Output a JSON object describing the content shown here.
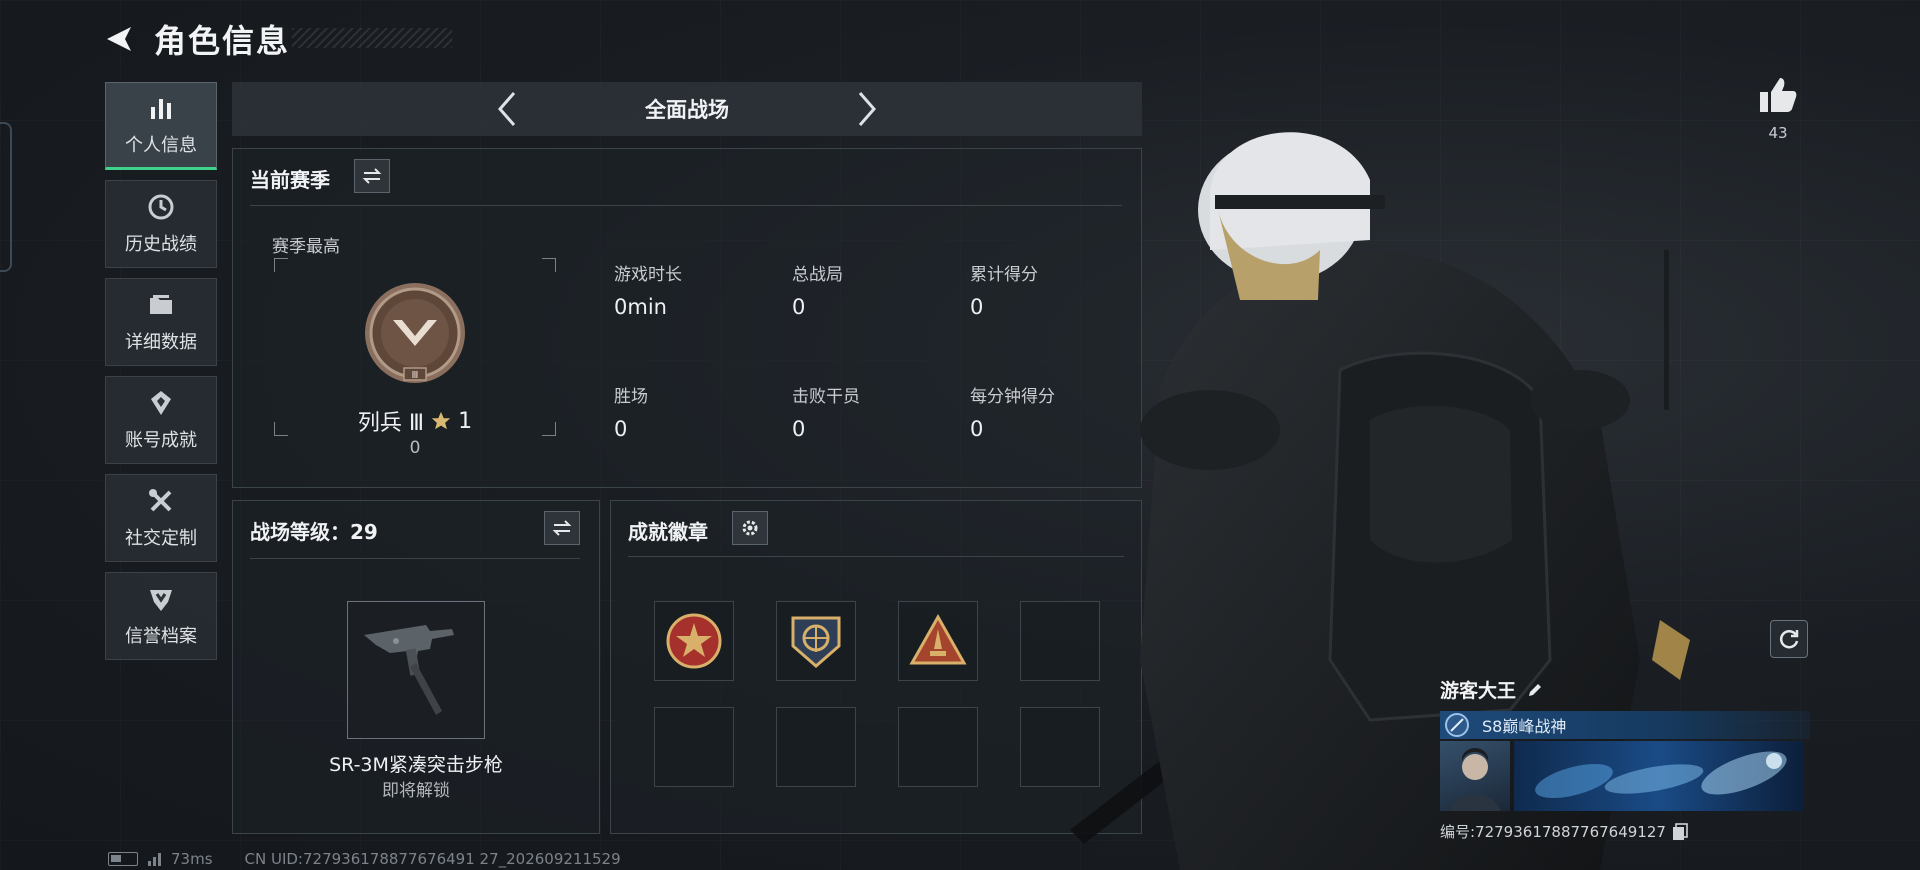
{
  "header": {
    "title": "角色信息"
  },
  "sidenav": {
    "items": [
      {
        "label": "个人信息",
        "active": true,
        "icon": "bar-chart-icon"
      },
      {
        "label": "历史战绩",
        "active": false,
        "icon": "history-clock-icon"
      },
      {
        "label": "详细数据",
        "active": false,
        "icon": "folder-stack-icon"
      },
      {
        "label": "账号成就",
        "active": false,
        "icon": "achievement-medal-icon"
      },
      {
        "label": "社交定制",
        "active": false,
        "icon": "tools-icon"
      },
      {
        "label": "信誉档案",
        "active": false,
        "icon": "shield-icon"
      }
    ],
    "active_color": "#3fd28b"
  },
  "modebar": {
    "title": "全面战场"
  },
  "season": {
    "title": "当前赛季",
    "best_label": "赛季最高",
    "rank_name": "列兵 Ⅲ",
    "rank_stars": "1",
    "rank_points": "0",
    "emblem_numeral": "Ⅲ",
    "stats": [
      {
        "label": "游戏时长",
        "value": "0min"
      },
      {
        "label": "总战局",
        "value": "0"
      },
      {
        "label": "累计得分",
        "value": "0"
      },
      {
        "label": "胜场",
        "value": "0"
      },
      {
        "label": "击败干员",
        "value": "0"
      },
      {
        "label": "每分钟得分",
        "value": "0"
      }
    ]
  },
  "level": {
    "title": "战场等级：29",
    "weapon_name": "SR-3M紧凑突击步枪",
    "weapon_status": "即将解锁"
  },
  "badges": {
    "title": "成就徽章",
    "slots": [
      "red-star-badge-icon",
      "globe-anchor-badge-icon",
      "rocket-triangle-badge-icon",
      "empty",
      "empty",
      "empty",
      "empty",
      "empty"
    ]
  },
  "like": {
    "count": "43"
  },
  "profile": {
    "name": "游客大王",
    "title": "S8巅峰战神",
    "id": "编号:7279361788776764912​7"
  },
  "status": {
    "ping": "73ms",
    "uid": "CN UID:727936178877676491 27_202609211529"
  }
}
